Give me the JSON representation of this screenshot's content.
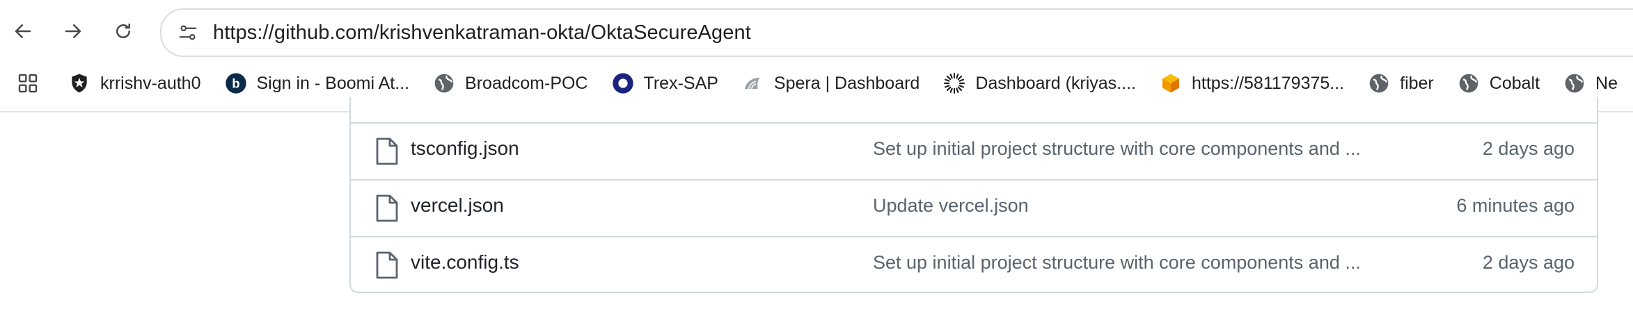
{
  "browser": {
    "url": "https://github.com/krishvenkatraman-okta/OktaSecureAgent",
    "bookmarks": [
      {
        "label": "krrishv-auth0",
        "icon": "shield-icon"
      },
      {
        "label": "Sign in - Boomi At...",
        "icon": "boomi-b-icon"
      },
      {
        "label": "Broadcom-POC",
        "icon": "globe-icon"
      },
      {
        "label": "Trex-SAP",
        "icon": "okta-ring-icon"
      },
      {
        "label": "Spera | Dashboard",
        "icon": "spera-icon"
      },
      {
        "label": "Dashboard (kriyas....",
        "icon": "sunburst-icon"
      },
      {
        "label": "https://581179375...",
        "icon": "cube-icon"
      },
      {
        "label": "fiber",
        "icon": "globe-icon"
      },
      {
        "label": "Cobalt",
        "icon": "globe-icon"
      },
      {
        "label": "Ne",
        "icon": "globe-icon"
      }
    ]
  },
  "files": [
    {
      "name": "tsconfig.json",
      "commit": "Set up initial project structure with core components and ...",
      "date": "2 days ago"
    },
    {
      "name": "vercel.json",
      "commit": "Update vercel.json",
      "date": "6 minutes ago"
    },
    {
      "name": "vite.config.ts",
      "commit": "Set up initial project structure with core components and ...",
      "date": "2 days ago"
    }
  ]
}
